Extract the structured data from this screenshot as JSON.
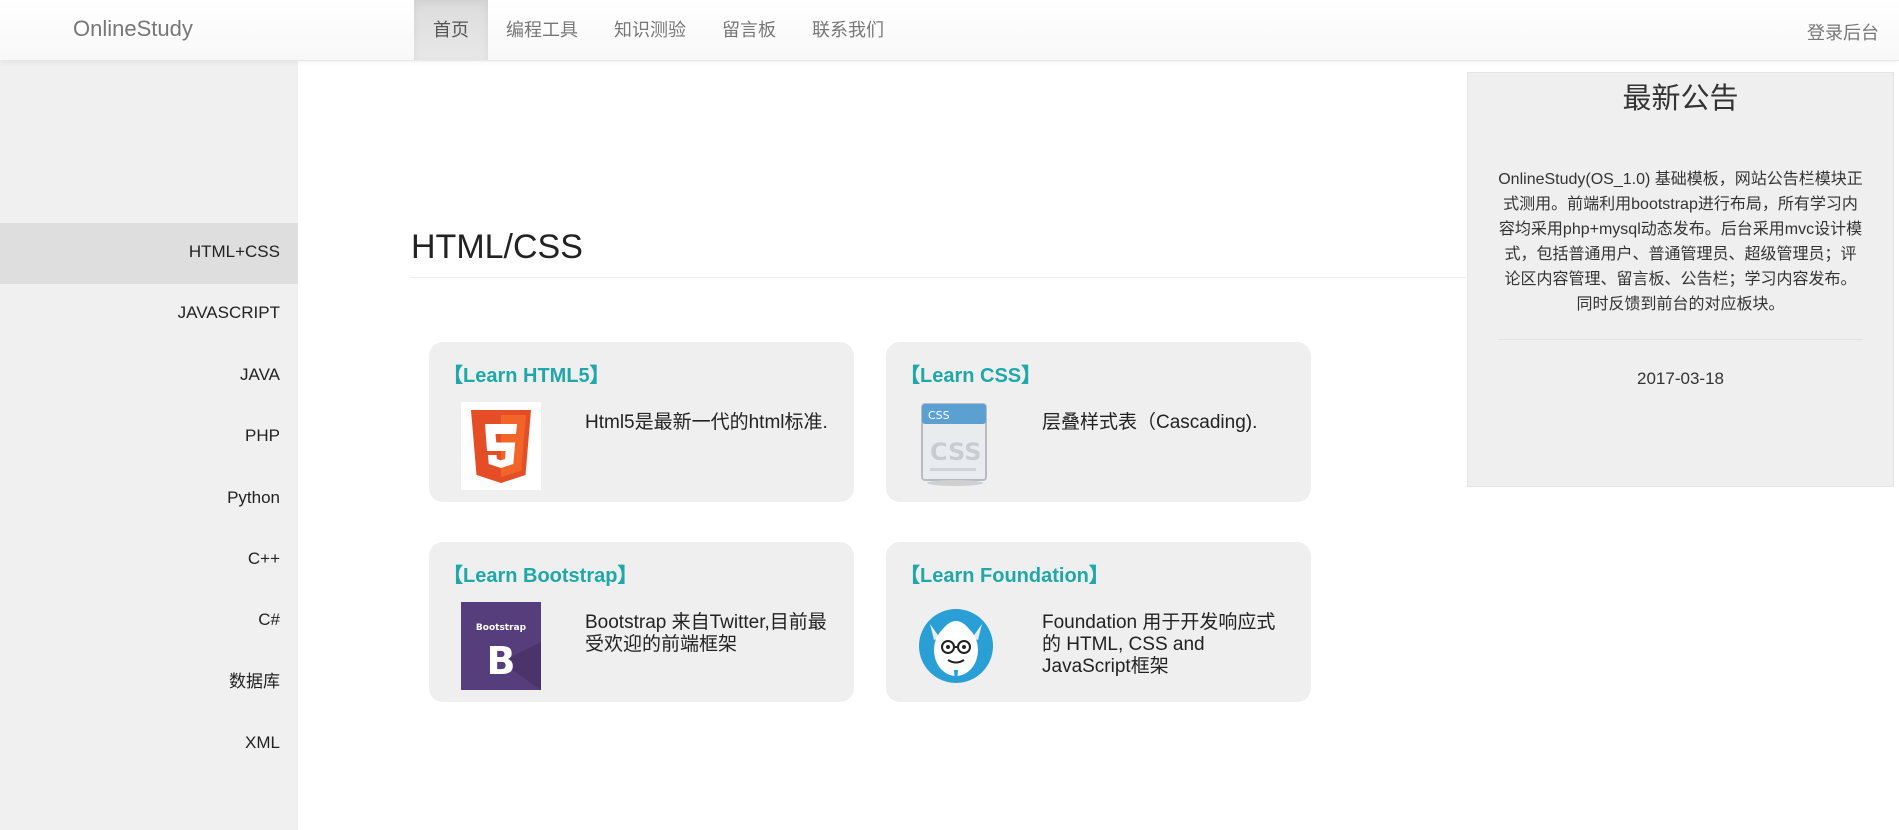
{
  "navbar": {
    "brand": "OnlineStudy",
    "items": [
      {
        "label": "首页",
        "active": true
      },
      {
        "label": "编程工具"
      },
      {
        "label": "知识测验"
      },
      {
        "label": "留言板"
      },
      {
        "label": "联系我们"
      }
    ],
    "login": "登录后台"
  },
  "sidebar": {
    "items": [
      "HTML+CSS",
      "JAVASCRIPT",
      "JAVA",
      "PHP",
      "Python",
      "C++",
      "C#",
      "数据库",
      "XML"
    ],
    "active_index": 0
  },
  "main": {
    "section_title": "HTML/CSS",
    "cards": [
      {
        "title": "【Learn HTML5】",
        "desc": "Html5是最新一代的html标准.",
        "icon": "html5-logo-icon"
      },
      {
        "title": "【Learn CSS】",
        "desc": "层叠样式表（Cascading).",
        "icon": "css-file-icon"
      },
      {
        "title": "【Learn Bootstrap】",
        "desc": "Bootstrap 来自Twitter,目前最受欢迎的前端框架",
        "icon": "bootstrap-logo-icon"
      },
      {
        "title": "【Learn Foundation】",
        "desc": "Foundation 用于开发响应式的 HTML, CSS and JavaScript框架",
        "icon": "foundation-yeti-icon"
      }
    ]
  },
  "notice": {
    "title": "最新公告",
    "body": "OnlineStudy(OS_1.0) 基础模板，网站公告栏模块正式测用。前端利用bootstrap进行布局，所有学习内容均采用php+mysql动态发布。后台采用mvc设计模式，包括普通用户、普通管理员、超级管理员；评论区内容管理、留言板、公告栏；学习内容发布。同时反馈到前台的对应板块。",
    "date": "2017-03-18"
  },
  "colors": {
    "accent": "#20a8a8",
    "sidebar_bg": "#f0f0f0",
    "card_bg": "#efefef",
    "html5_orange": "#e44d26",
    "bootstrap_purple": "#563d7c",
    "foundation_blue": "#2a9fd6"
  }
}
